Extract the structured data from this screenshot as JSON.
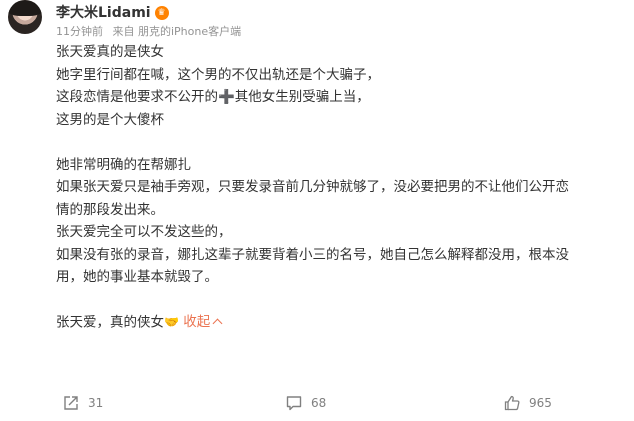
{
  "author": {
    "name": "李大米Lidami",
    "badge_icon": "vip-icon"
  },
  "meta": {
    "time": "11分钟前",
    "source": "来自 朋克的iPhone客户端"
  },
  "post": {
    "lines": [
      "张天爱真的是侠女",
      "她字里行间都在喊，这个男的不仅出轨还是个大骗子，",
      "这段恋情是他要求不公开的➕其他女生别受骗上当，",
      "这男的是个大傻杯",
      "",
      "她非常明确的在帮娜扎",
      "如果张天爱只是袖手旁观，只要发录音前几分钟就够了，没必要把男的不让他们公开恋",
      "情的那段发出来。",
      "张天爱完全可以不发这些的，",
      "如果没有张的录音，娜扎这辈子就要背着小三的名号，她自己怎么解释都没用，根本没",
      "用，她的事业基本就毁了。",
      ""
    ],
    "last_line_text": "张天爱，真的侠女",
    "last_line_emoji": "🤝",
    "collapse_label": "收起"
  },
  "actions": {
    "repost_count": "31",
    "comment_count": "68",
    "like_count": "965"
  },
  "colors": {
    "accent": "#eb7350",
    "meta_gray": "#939393",
    "icon_gray": "#808080"
  }
}
